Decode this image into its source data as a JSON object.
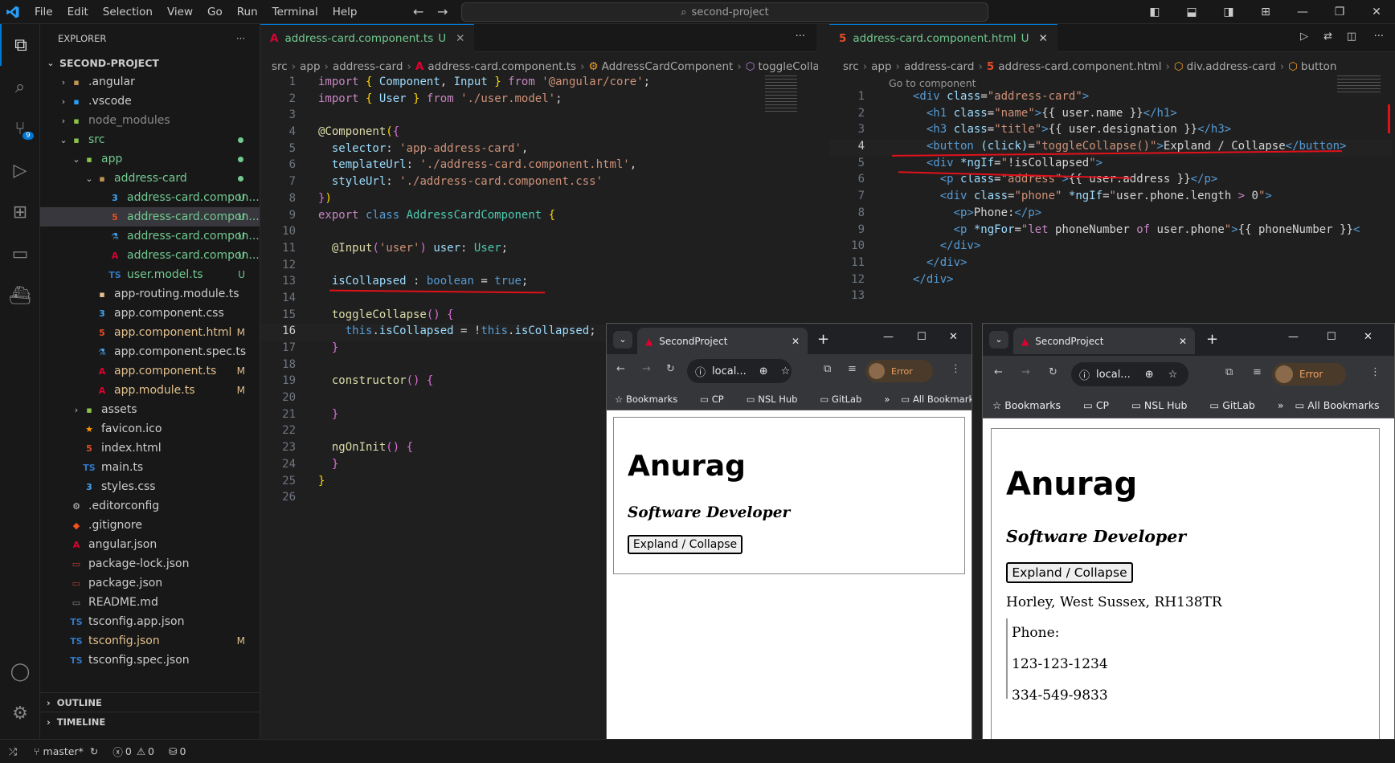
{
  "menu": [
    "File",
    "Edit",
    "Selection",
    "View",
    "Go",
    "Run",
    "Terminal",
    "Help"
  ],
  "command_center": "second-project",
  "explorer": {
    "title": "EXPLORER",
    "project": "SECOND-PROJECT",
    "items": [
      {
        "label": ".angular",
        "badge": ""
      },
      {
        "label": ".vscode",
        "badge": ""
      },
      {
        "label": "node_modules",
        "badge": ""
      },
      {
        "label": "src",
        "badge": ""
      },
      {
        "label": "app",
        "badge": ""
      },
      {
        "label": "address-card",
        "badge": ""
      },
      {
        "label": "address-card.compon...",
        "badge": "U"
      },
      {
        "label": "address-card.compon...",
        "badge": "U"
      },
      {
        "label": "address-card.compon...",
        "badge": "U"
      },
      {
        "label": "address-card.compon...",
        "badge": "U"
      },
      {
        "label": "user.model.ts",
        "badge": "U"
      },
      {
        "label": "app-routing.module.ts",
        "badge": ""
      },
      {
        "label": "app.component.css",
        "badge": ""
      },
      {
        "label": "app.component.html",
        "badge": "M"
      },
      {
        "label": "app.component.spec.ts",
        "badge": ""
      },
      {
        "label": "app.component.ts",
        "badge": "M"
      },
      {
        "label": "app.module.ts",
        "badge": "M"
      },
      {
        "label": "assets",
        "badge": ""
      },
      {
        "label": "favicon.ico",
        "badge": ""
      },
      {
        "label": "index.html",
        "badge": ""
      },
      {
        "label": "main.ts",
        "badge": ""
      },
      {
        "label": "styles.css",
        "badge": ""
      },
      {
        "label": ".editorconfig",
        "badge": ""
      },
      {
        "label": ".gitignore",
        "badge": ""
      },
      {
        "label": "angular.json",
        "badge": ""
      },
      {
        "label": "package-lock.json",
        "badge": ""
      },
      {
        "label": "package.json",
        "badge": ""
      },
      {
        "label": "README.md",
        "badge": ""
      },
      {
        "label": "tsconfig.app.json",
        "badge": ""
      },
      {
        "label": "tsconfig.json",
        "badge": "M"
      },
      {
        "label": "tsconfig.spec.json",
        "badge": ""
      }
    ],
    "outline": "OUTLINE",
    "timeline": "TIMELINE"
  },
  "editor_left": {
    "tab": "address-card.component.ts",
    "tab_badge": "U",
    "crumbs": [
      "src",
      "app",
      "address-card",
      "address-card.component.ts",
      "AddressCardComponent",
      "toggleCollapse"
    ]
  },
  "editor_right": {
    "tab": "address-card.component.html",
    "tab_badge": "U",
    "crumbs": [
      "src",
      "app",
      "address-card",
      "address-card.component.html",
      "div.address-card",
      "button"
    ],
    "codelens": "Go to component"
  },
  "status": {
    "branch": "master*",
    "errors": "0",
    "warnings": "0",
    "ports": "0"
  },
  "browser": {
    "tab_title": "SecondProject",
    "url": "local...",
    "profile": "Error",
    "bookmarks": [
      "Bookmarks",
      "CP",
      "NSL Hub",
      "GitLab",
      "All Bookmarks"
    ]
  },
  "card_collapsed": {
    "name": "Anurag",
    "designation": "Software Developer",
    "button": "Expland / Collapse"
  },
  "card_expanded": {
    "name": "Anurag",
    "designation": "Software Developer",
    "button": "Expland / Collapse",
    "address": "Horley, West Sussex, RH138TR",
    "phone_label": "Phone:",
    "phones": [
      "123-123-1234",
      "334-549-9833"
    ]
  },
  "colors": {
    "accent": "#0078d4",
    "untracked": "#73c991",
    "modified": "#e2c08d",
    "annotation": "#e3101a"
  }
}
